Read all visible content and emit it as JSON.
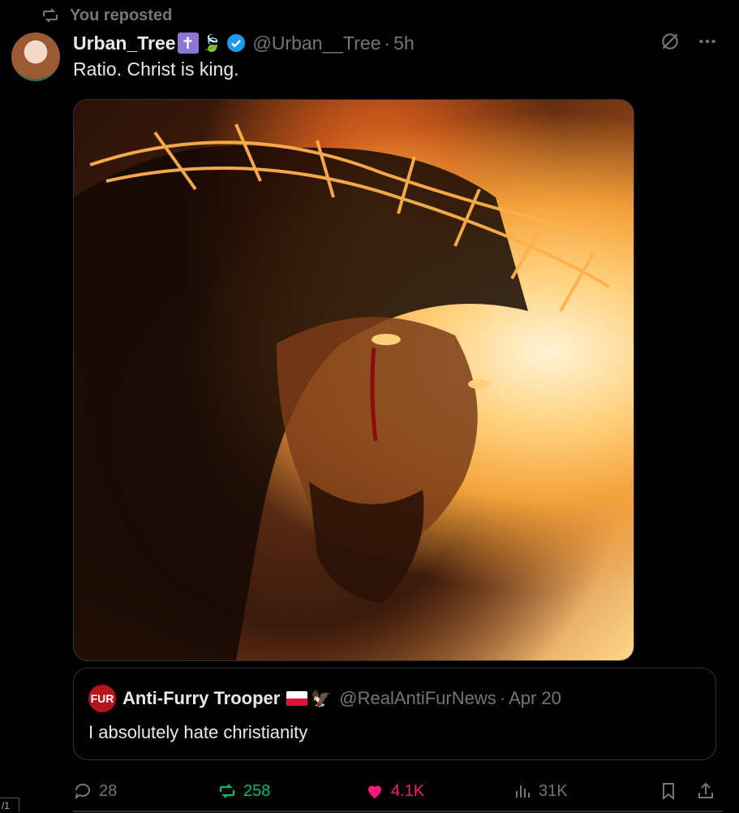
{
  "repost_notice": "You reposted",
  "post": {
    "display_name": "Urban_Tree",
    "badge_glyph": "✝",
    "emoji": "🍃",
    "handle": "@Urban__Tree",
    "separator": "·",
    "time": "5h",
    "text": "Ratio. Christ is king.",
    "media_icon": "artwork-image"
  },
  "quote": {
    "avatar_text": "FUR",
    "display_name": "Anti-Furry Trooper",
    "emoji": "🦅",
    "handle": "@RealAntiFurNews",
    "separator": "·",
    "date": "Apr 20",
    "text": "I absolutely hate christianity"
  },
  "actions": {
    "replies": "28",
    "reposts": "258",
    "likes": "4.1K",
    "views": "31K"
  },
  "sidebar_fragment": "/1",
  "colors": {
    "background": "#000000",
    "text": "#e7e9ea",
    "muted": "#71767b",
    "repost_active": "#00ba7c",
    "like_active": "#f91880",
    "verified": "#1d9bf0"
  }
}
